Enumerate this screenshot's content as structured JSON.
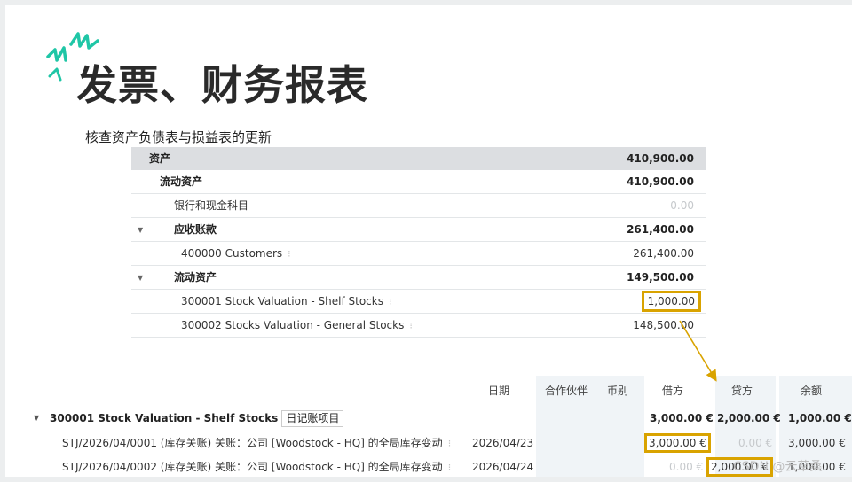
{
  "slide": {
    "title": "发票、财务报表",
    "subtitle": "核查资产负债表与损益表的更新"
  },
  "balance_sheet": {
    "rows": [
      {
        "label": "资产",
        "value": "410,900.00"
      },
      {
        "label": "流动资产",
        "value": "410,900.00"
      },
      {
        "label": "银行和现金科目",
        "value": "0.00"
      },
      {
        "label": "应收账款",
        "value": "261,400.00"
      },
      {
        "label": "400000 Customers",
        "value": "261,400.00"
      },
      {
        "label": "流动资产",
        "value": "149,500.00"
      },
      {
        "label": "300001 Stock Valuation - Shelf Stocks",
        "value": "1,000.00"
      },
      {
        "label": "300002 Stocks Valuation - General Stocks",
        "value": "148,500.00"
      }
    ]
  },
  "ledger": {
    "headers": {
      "date": "日期",
      "partner": "合作伙伴",
      "currency": "币别",
      "debit": "借方",
      "credit": "贷方",
      "balance": "余额"
    },
    "group": {
      "label": "300001 Stock Valuation - Shelf Stocks",
      "tag": "日记账项目",
      "debit": "3,000.00 €",
      "credit": "2,000.00 €",
      "balance": "1,000.00 €"
    },
    "entries": [
      {
        "label": "STJ/2026/04/0001 (库存关账) 关账：公司 [Woodstock - HQ] 的全局库存变动",
        "date": "2026/04/23",
        "debit": "3,000.00 €",
        "credit": "0.00 €",
        "balance": "3,000.00 €"
      },
      {
        "label": "STJ/2026/04/0002 (库存关账) 关账：公司 [Woodstock - HQ] 的全局库存变动",
        "date": "2026/04/24",
        "debit": "0.00 €",
        "credit": "2,000.00 €",
        "balance": "1,000.00 €"
      }
    ]
  },
  "watermark": "CSDN @云草桑",
  "colors": {
    "highlight": "#d9a300",
    "spark": "#1fc6a6",
    "header_bg": "#dcdee1"
  }
}
